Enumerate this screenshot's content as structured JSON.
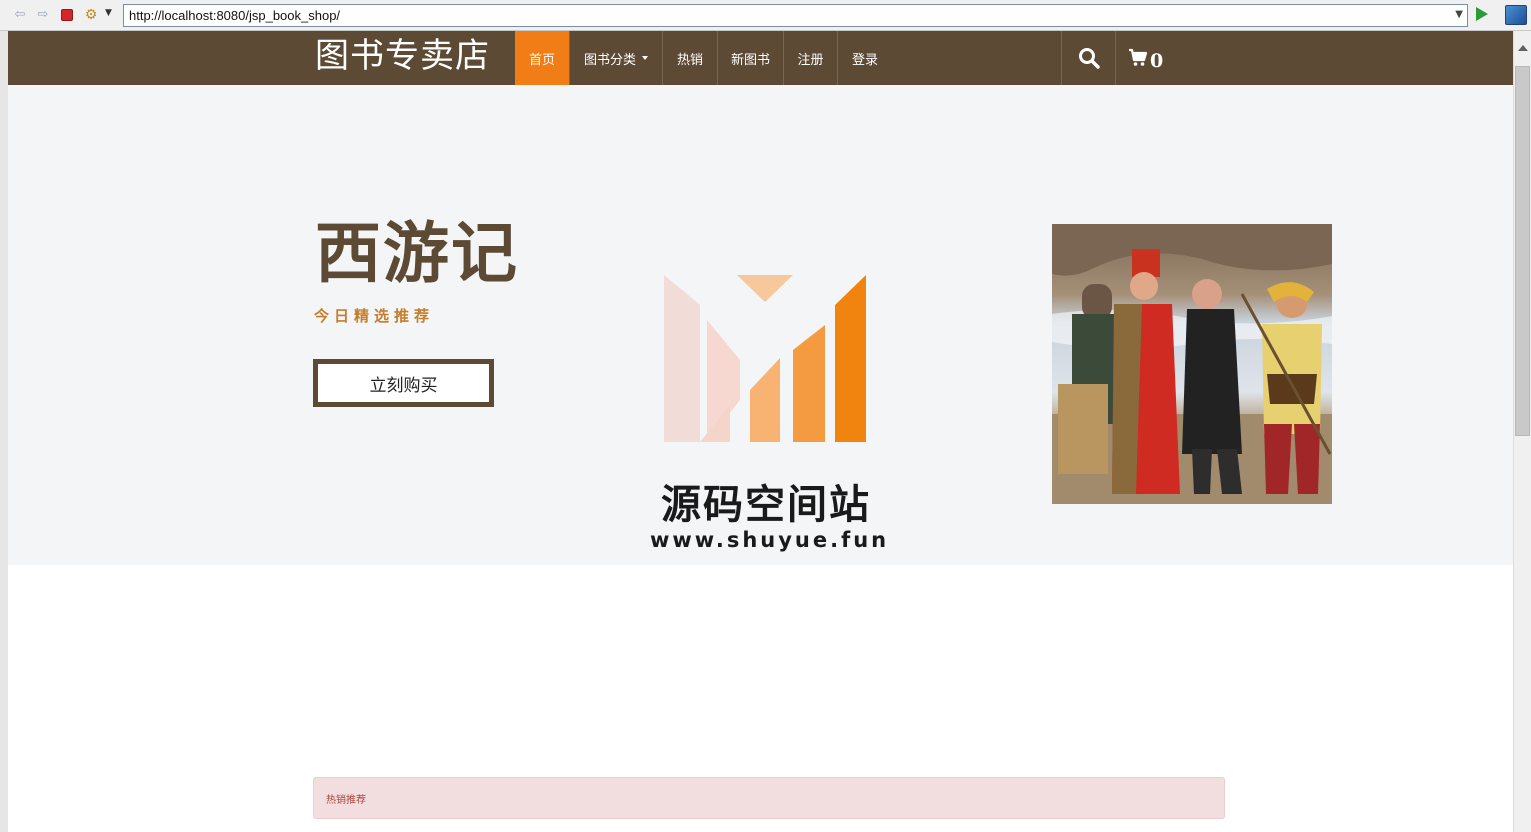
{
  "browser": {
    "url": "http://localhost:8080/jsp_book_shop/"
  },
  "site": {
    "brand": "图书专卖店",
    "menu": [
      {
        "label": "首页",
        "active": true
      },
      {
        "label": "图书分类",
        "dropdown": true
      },
      {
        "label": "热销"
      },
      {
        "label": "新图书"
      },
      {
        "label": "注册"
      },
      {
        "label": "登录"
      }
    ],
    "cart_count": "0"
  },
  "hero": {
    "title": "西游记",
    "subtitle": "今日精选推荐",
    "buy_label": "立刻购买"
  },
  "watermark": {
    "title": "源码空间站",
    "url": "www.shuyue.fun"
  },
  "sections": {
    "hot_title": "热销推荐"
  },
  "colors": {
    "nav_bg": "#5d4a35",
    "active_tab": "#f07d16",
    "hero_bg": "#f3f5f6",
    "subtitle": "#c57e2b",
    "panel_bg": "#f2dede",
    "panel_text": "#a94442"
  }
}
